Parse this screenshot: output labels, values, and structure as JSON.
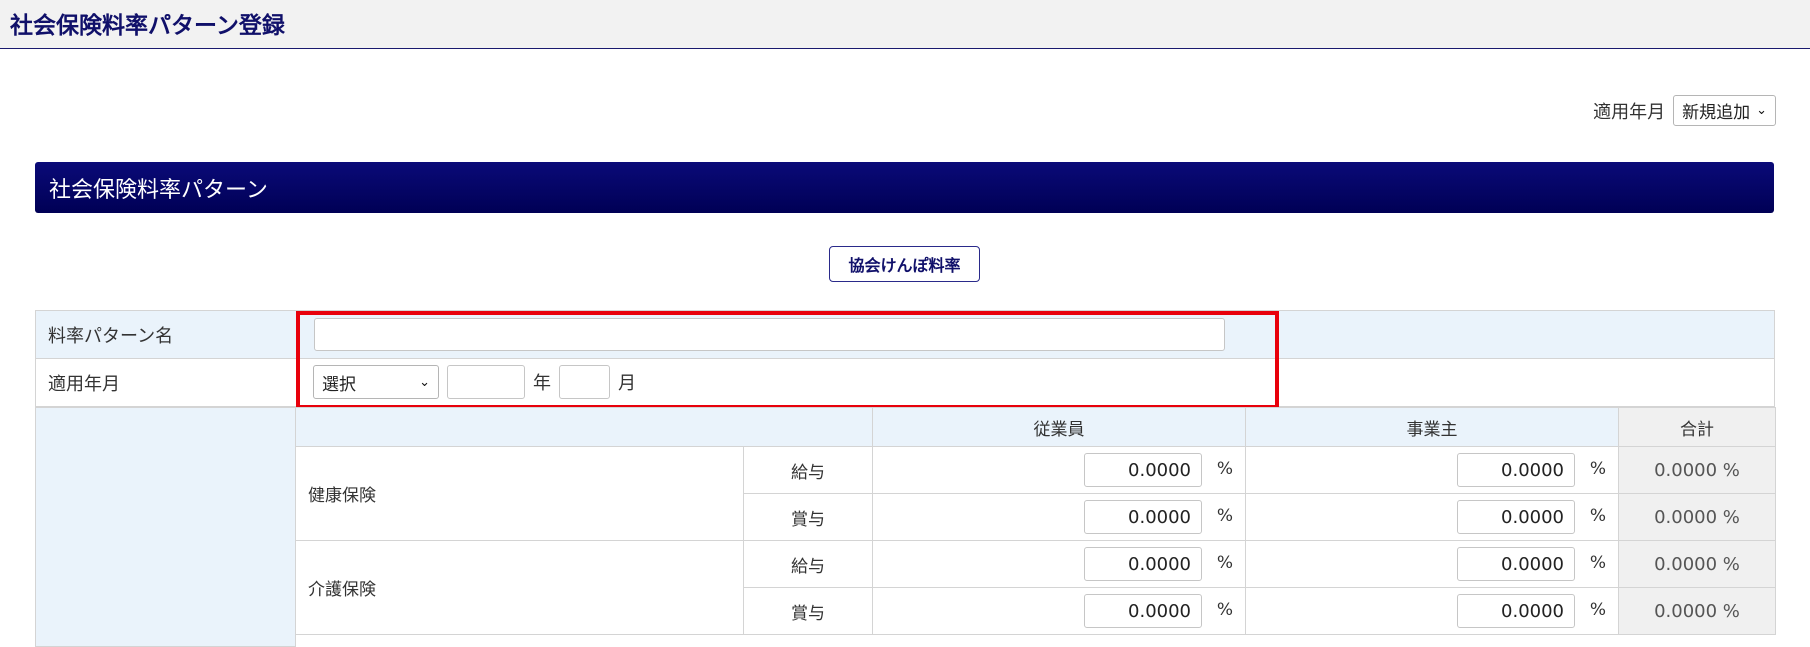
{
  "header": {
    "title": "社会保険料率パターン登録"
  },
  "apply_month_select": {
    "label": "適用年月",
    "value": "新規追加"
  },
  "section": {
    "title": "社会保険料率パターン"
  },
  "kyokai_button": {
    "label": "協会けんぽ料率"
  },
  "form": {
    "pattern_name": {
      "label": "料率パターン名",
      "value": ""
    },
    "apply_month": {
      "label": "適用年月",
      "era_select": "選択",
      "year_unit": "年",
      "month_unit": "月"
    }
  },
  "rates": {
    "columns": [
      "従業員",
      "事業主",
      "合計"
    ],
    "percent_sign": "%",
    "groups": [
      {
        "name": "健康保険",
        "rows": [
          {
            "kind": "給与",
            "employee": "0.0000",
            "employer": "0.0000",
            "total": "0.0000 %"
          },
          {
            "kind": "賞与",
            "employee": "0.0000",
            "employer": "0.0000",
            "total": "0.0000 %"
          }
        ]
      },
      {
        "name": "介護保険",
        "rows": [
          {
            "kind": "給与",
            "employee": "0.0000",
            "employer": "0.0000",
            "total": "0.0000 %"
          },
          {
            "kind": "賞与",
            "employee": "0.0000",
            "employer": "0.0000",
            "total": "0.0000 %"
          }
        ]
      }
    ]
  },
  "colors": {
    "navy": "#000066",
    "highlight": "#e8000b",
    "label_bg": "#eaf3fb",
    "total_bg": "#f0f0f0"
  }
}
